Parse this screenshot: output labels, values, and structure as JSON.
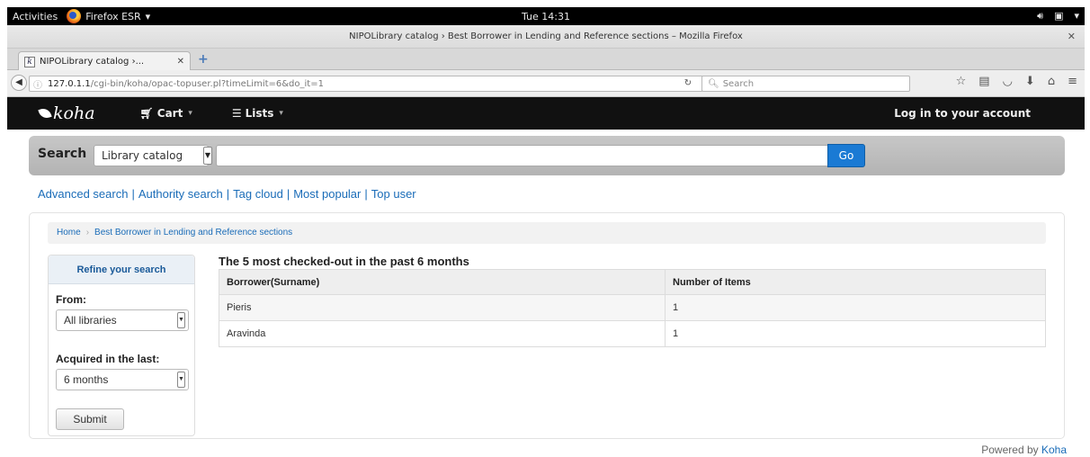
{
  "os_bar": {
    "activities": "Activities",
    "app_name": "Firefox ESR",
    "clock": "Tue 14:31"
  },
  "window": {
    "title": "NIPOLibrary catalog › Best Borrower in Lending and Reference sections – Mozilla Firefox"
  },
  "tab": {
    "label": "NIPOLibrary catalog ›..."
  },
  "url": {
    "host": "127.0.1.1",
    "path": "/cgi-bin/koha/opac-topuser.pl?timeLimit=6&do_it=1"
  },
  "browser_search": {
    "placeholder": "Search"
  },
  "koha_nav": {
    "logo": "koha",
    "cart": "Cart",
    "lists": "Lists",
    "login": "Log in to your account"
  },
  "search": {
    "label": "Search",
    "scope": "Library catalog",
    "go": "Go"
  },
  "links": {
    "advanced": "Advanced search",
    "authority": "Authority search",
    "tag_cloud": "Tag cloud",
    "most_popular": "Most popular",
    "top_user": "Top user"
  },
  "breadcrumb": {
    "home": "Home",
    "current": "Best Borrower in Lending and Reference sections"
  },
  "sidebar": {
    "title": "Refine your search",
    "from_label": "From:",
    "from_value": "All libraries",
    "acquired_label": "Acquired in the last:",
    "acquired_value": "6 months",
    "submit": "Submit"
  },
  "results": {
    "title": "The 5 most checked-out in the past 6 months",
    "headers": [
      "Borrower(Surname)",
      "Number of Items"
    ],
    "rows": [
      [
        "Pieris",
        "1"
      ],
      [
        "Aravinda",
        "1"
      ]
    ]
  },
  "footer": {
    "powered_prefix": "Powered by",
    "powered_link": "Koha"
  },
  "colors": {
    "accent": "#1a7ad4",
    "link": "#1a6cb8",
    "nav_bg": "#111111"
  }
}
